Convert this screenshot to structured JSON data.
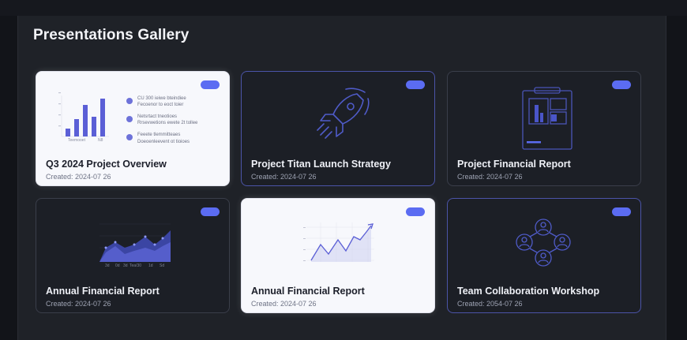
{
  "page": {
    "title": "Presentations Gallery"
  },
  "colors": {
    "accent": "#5b6cf2",
    "background": "#1f2228",
    "card_dark": "#1c1f26",
    "card_light": "#f7f8fc"
  },
  "cards": [
    {
      "title": "Q3 2024 Project Overview",
      "created": "Created: 2024-07 26",
      "theme": "light",
      "thumbnail": "bar-chart-with-bullets",
      "thumb_text": {
        "bullets": [
          "CU 300 ieiwe bteindiee",
          "Fecoenor to eoct toier",
          "Netsrtact tneotioes",
          "Rrsevwetions ewete 2t tollee",
          "Feeete tlemmitteaes",
          "Doeoenleevent ot tioioes"
        ],
        "axis_labels": [
          "Teemooet",
          "N8"
        ]
      }
    },
    {
      "title": "Project Titan Launch Strategy",
      "created": "Created: 2024-07 26",
      "theme": "dark",
      "thumbnail": "rocket-icon"
    },
    {
      "title": "Project Financial Report",
      "created": "Created: 2024-07 26",
      "theme": "dark",
      "thumbnail": "clipboard-report-icon"
    },
    {
      "title": "Annual Financial Report",
      "created": "Created: 2024-07 26",
      "theme": "dark",
      "thumbnail": "area-chart",
      "thumb_text": {
        "axis_labels": [
          "3d",
          "0d",
          "3d",
          "Tea/30",
          "1d",
          "Sd"
        ]
      }
    },
    {
      "title": "Annual Financial Report",
      "created": "Created: 2024-07 26",
      "theme": "light",
      "thumbnail": "line-chart-trend"
    },
    {
      "title": "Team Collaboration Workshop",
      "created": "Created: 2054-07 26",
      "theme": "dark",
      "thumbnail": "team-network-icon"
    }
  ]
}
